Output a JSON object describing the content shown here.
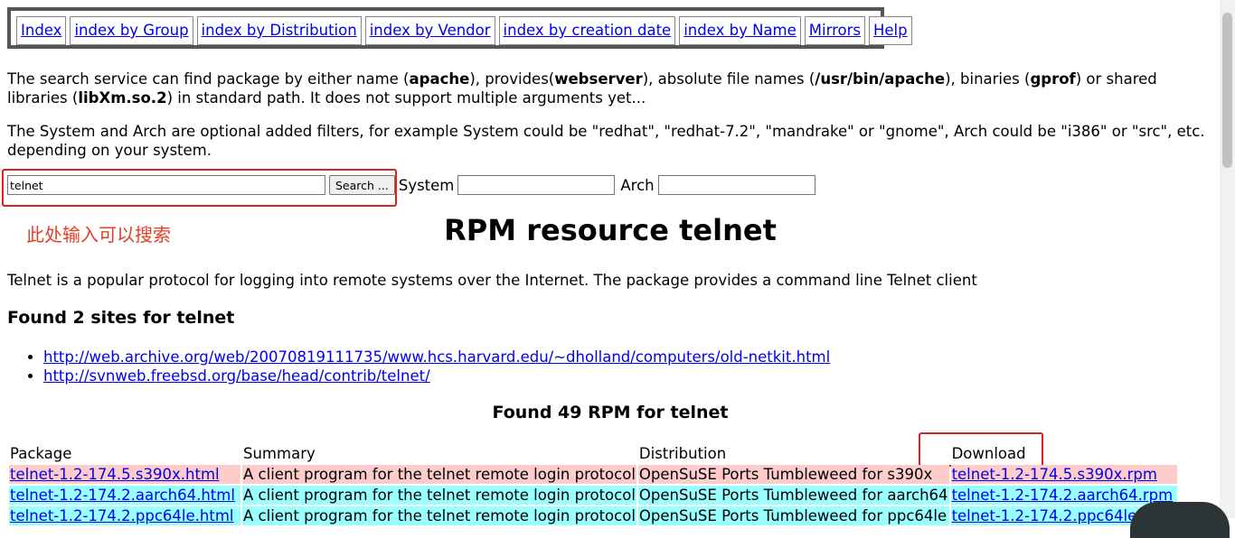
{
  "nav": [
    "Index",
    "index by Group",
    "index by Distribution",
    "index by Vendor",
    "index by creation date",
    "index by Name",
    "Mirrors",
    "Help"
  ],
  "intro": {
    "p1_a": "The search service can find package by either name (",
    "p1_b1": "apache",
    "p1_c": "), provides(",
    "p1_b2": "webserver",
    "p1_d": "), absolute file names (",
    "p1_b3": "/usr/bin/apache",
    "p1_e": "), binaries (",
    "p1_b4": "gprof",
    "p1_f": ") or shared libraries (",
    "p1_b5": "libXm.so.2",
    "p1_g": ") in standard path. It does not support multiple arguments yet...",
    "p2": "The System and Arch are optional added filters, for example System could be \"redhat\", \"redhat-7.2\", \"mandrake\" or \"gnome\", Arch could be \"i386\" or \"src\", etc. depending on your system."
  },
  "search": {
    "query": "telnet",
    "button": "Search ...",
    "system_label": "System",
    "system_value": "",
    "arch_label": "Arch",
    "arch_value": ""
  },
  "annotation": "此处输入可以搜索",
  "title": "RPM resource telnet",
  "description": "Telnet is a popular protocol for logging into remote systems over the Internet. The package provides a command line Telnet client",
  "sites_heading": "Found 2 sites for telnet",
  "sites": [
    "http://web.archive.org/web/20070819111735/www.hcs.harvard.edu/~dholland/computers/old-netkit.html",
    "http://svnweb.freebsd.org/base/head/contrib/telnet/"
  ],
  "rpm_heading": "Found 49 RPM for telnet",
  "table": {
    "headers": [
      "Package",
      "Summary",
      "Distribution",
      "Download"
    ],
    "rows": [
      [
        "telnet-1.2-174.5.s390x.html",
        "A client program for the telnet remote login protocol",
        "OpenSuSE Ports Tumbleweed for s390x",
        "telnet-1.2-174.5.s390x.rpm"
      ],
      [
        "telnet-1.2-174.2.aarch64.html",
        "A client program for the telnet remote login protocol",
        "OpenSuSE Ports Tumbleweed for aarch64",
        "telnet-1.2-174.2.aarch64.rpm"
      ],
      [
        "telnet-1.2-174.2.ppc64le.html",
        "A client program for the telnet remote login protocol",
        "OpenSuSE Ports Tumbleweed for ppc64le",
        "telnet-1.2-174.2.ppc64le.rpm"
      ]
    ]
  },
  "colors": {
    "row_odd": "#ffcccc",
    "row_even": "#99ffff",
    "annotation": "#e02020",
    "link": "#0000ee"
  }
}
